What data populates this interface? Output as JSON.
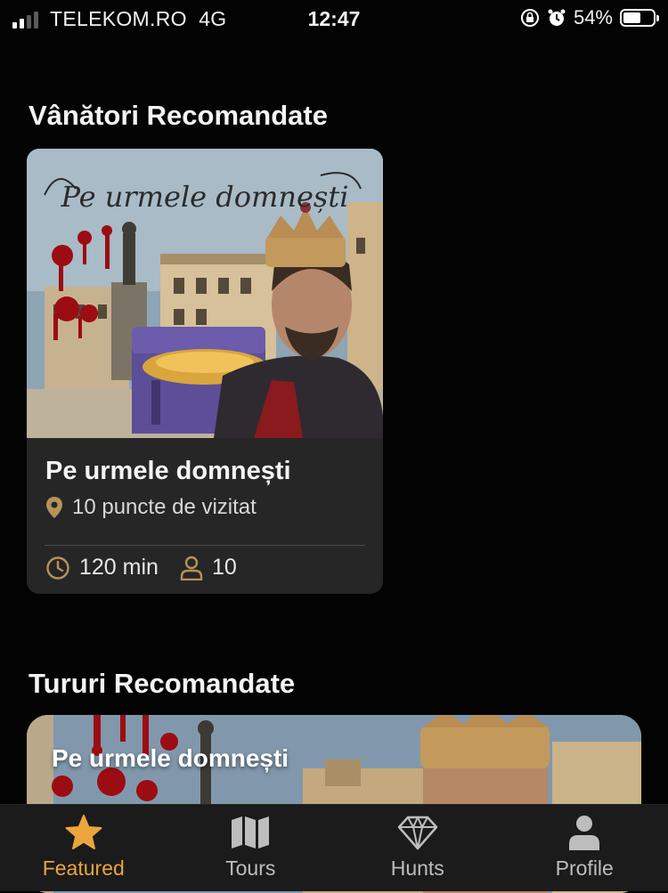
{
  "status_bar": {
    "carrier": "TELEKOM.RO",
    "network": "4G",
    "time": "12:47",
    "battery": "54%"
  },
  "hunts_section": {
    "title": "Vânători Recomandate",
    "card": {
      "artwork_caption": "Pe urmele domnești",
      "title": "Pe urmele domnești",
      "points": "10 puncte de vizitat",
      "duration": "120 min",
      "participants": "10"
    }
  },
  "tours_section": {
    "title": "Tururi Recomandate",
    "card": {
      "title": "Pe urmele domnești"
    }
  },
  "tab_bar": {
    "tabs": [
      {
        "label": "Featured",
        "icon": "star-icon",
        "active": true
      },
      {
        "label": "Tours",
        "icon": "map-icon",
        "active": false
      },
      {
        "label": "Hunts",
        "icon": "diamond-icon",
        "active": false
      },
      {
        "label": "Profile",
        "icon": "person-icon",
        "active": false
      }
    ]
  },
  "colors": {
    "accent": "#eaa53c",
    "card_bg": "#262626",
    "background": "#030303",
    "tab_bar_bg": "#1b1b1b"
  }
}
